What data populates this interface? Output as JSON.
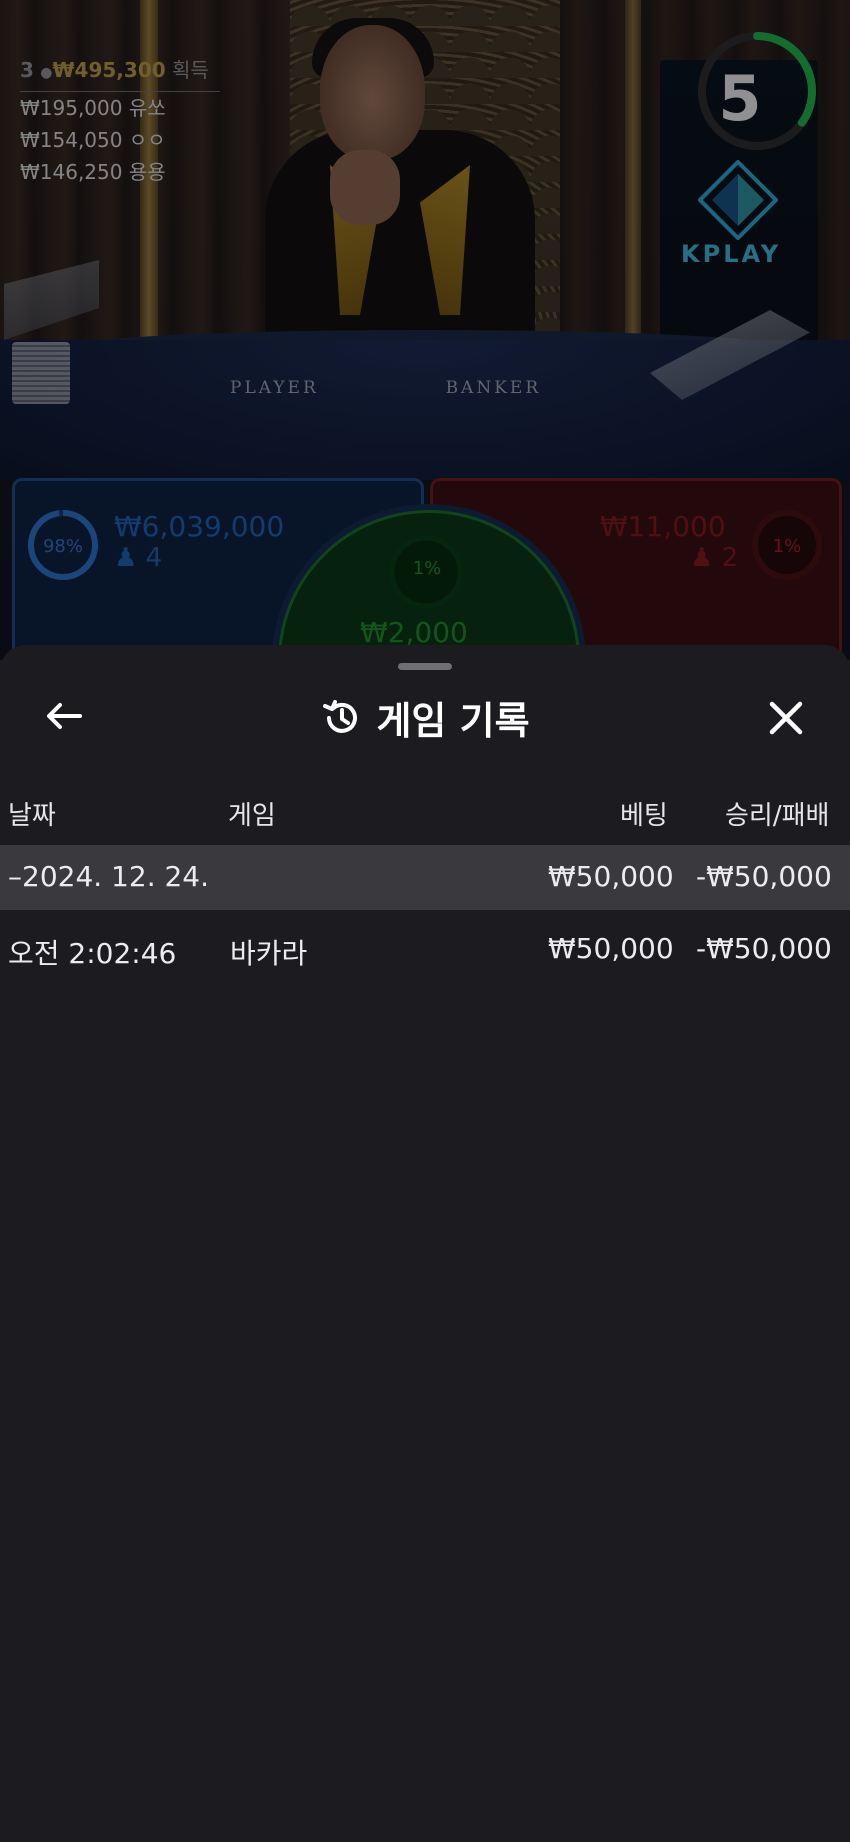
{
  "stream": {
    "table_player_label": "PLAYER",
    "table_banker_label": "BANKER",
    "brand": "KPLAY",
    "timer_value": "5"
  },
  "winners": {
    "count": "3",
    "total": "₩495,300",
    "total_suffix": "획득",
    "list": [
      {
        "amount": "₩195,000",
        "name": "유쏘"
      },
      {
        "amount": "₩154,050",
        "name": "ㅇㅇ"
      },
      {
        "amount": "₩146,250",
        "name": "용용"
      }
    ]
  },
  "bets": {
    "player": {
      "percent": "98%",
      "amount": "₩6,039,000",
      "players": "4"
    },
    "banker": {
      "percent": "1%",
      "amount": "₩11,000",
      "players": "2"
    },
    "tie": {
      "percent": "1%",
      "amount": "₩2,000"
    }
  },
  "colors": {
    "player": "#234a86",
    "banker": "#6b1d22",
    "tie": "#1f6d2a",
    "timer": "#1fb24b"
  },
  "history_sheet": {
    "title": "게임 기록",
    "title_icon": "history-icon",
    "back_icon": "arrow-left-icon",
    "close_icon": "close-icon",
    "columns": {
      "date": "날짜",
      "game": "게임",
      "bet": "베팅",
      "result": "승리/패배"
    },
    "day_group": {
      "date": "–2024. 12. 24.",
      "bet": "₩50,000",
      "result": "-₩50,000"
    },
    "rows": [
      {
        "time": "오전 2:02:46",
        "game": "바카라",
        "bet": "₩50,000",
        "result": "-₩50,000"
      }
    ]
  }
}
